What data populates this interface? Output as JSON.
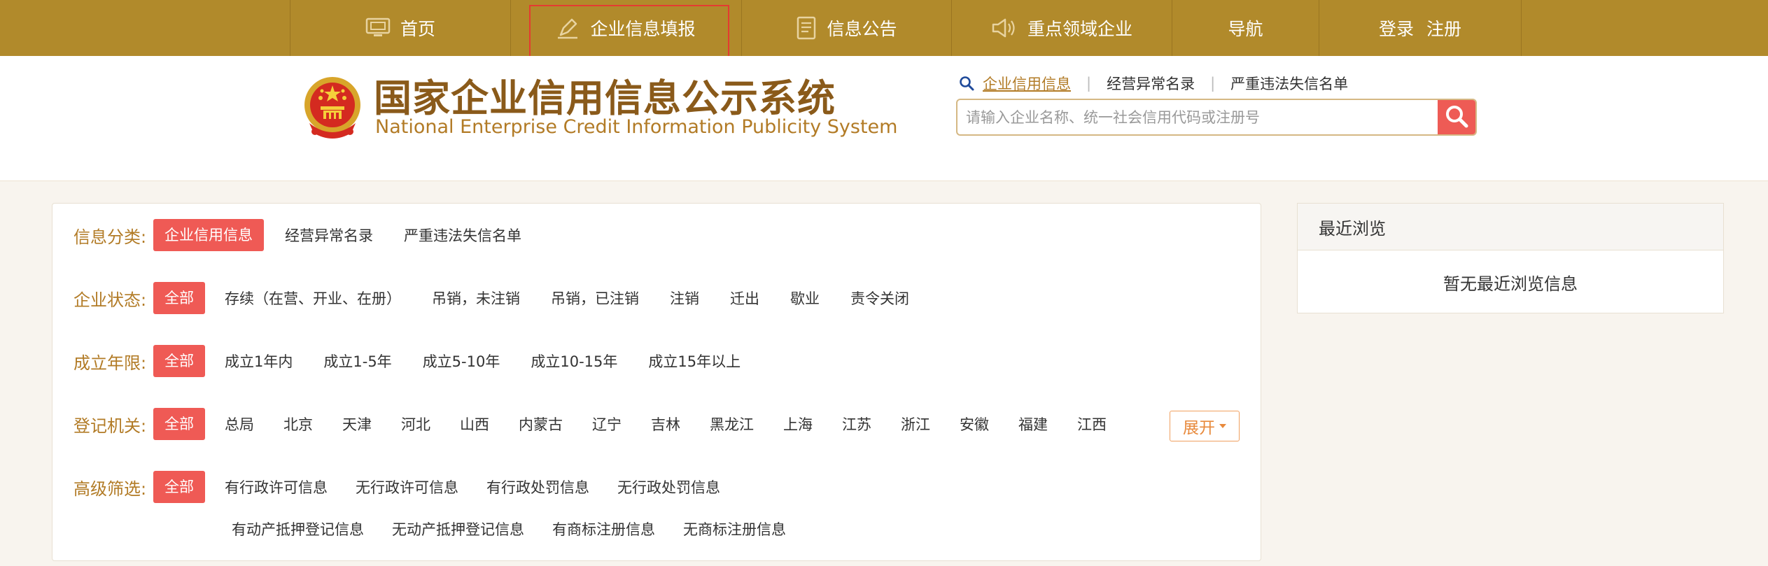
{
  "nav": {
    "home": "首页",
    "fill": "企业信息填报",
    "notice": "信息公告",
    "key": "重点领域企业",
    "guide": "导航",
    "login": "登录",
    "register": "注册"
  },
  "header": {
    "brand_cn": "国家企业信用信息公示系统",
    "brand_en": "National Enterprise Credit Information Publicity System"
  },
  "search": {
    "tabs": [
      "企业信用信息",
      "经营异常名录",
      "严重违法失信名单"
    ],
    "placeholder": "请输入企业名称、统一社会信用代码或注册号"
  },
  "filters": {
    "category": {
      "label": "信息分类:",
      "options": [
        "企业信用信息",
        "经营异常名录",
        "严重违法失信名单"
      ]
    },
    "status": {
      "label": "企业状态:",
      "options": [
        "全部",
        "存续（在营、开业、在册）",
        "吊销，未注销",
        "吊销，已注销",
        "注销",
        "迁出",
        "歇业",
        "责令关闭"
      ]
    },
    "years": {
      "label": "成立年限:",
      "options": [
        "全部",
        "成立1年内",
        "成立1-5年",
        "成立5-10年",
        "成立10-15年",
        "成立15年以上"
      ]
    },
    "authority": {
      "label": "登记机关:",
      "options": [
        "全部",
        "总局",
        "北京",
        "天津",
        "河北",
        "山西",
        "内蒙古",
        "辽宁",
        "吉林",
        "黑龙江",
        "上海",
        "江苏",
        "浙江",
        "安徽",
        "福建",
        "江西"
      ],
      "expand": "展开"
    },
    "advanced": {
      "label": "高级筛选:",
      "row1": [
        "全部",
        "有行政许可信息",
        "无行政许可信息",
        "有行政处罚信息",
        "无行政处罚信息"
      ],
      "row2": [
        "有动产抵押登记信息",
        "无动产抵押登记信息",
        "有商标注册信息",
        "无商标注册信息"
      ]
    }
  },
  "recent": {
    "title": "最近浏览",
    "empty": "暂无最近浏览信息"
  },
  "colors": {
    "nav_bg": "#b18a2b",
    "accent_red": "#ef5a55",
    "label_gold": "#b27b26",
    "page_bg": "#f8f4ee"
  }
}
